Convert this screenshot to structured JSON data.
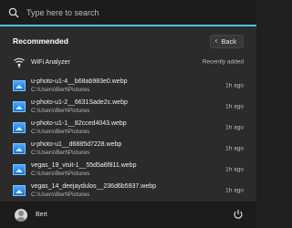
{
  "search": {
    "placeholder": "Type here to search"
  },
  "recommended": {
    "title": "Recommended",
    "back_label": "Back",
    "items": [
      {
        "name": "WiFi Analyzer",
        "sub": "",
        "time": "Recently added",
        "icon": "wifi-analyzer-icon"
      },
      {
        "name": "u-photo-u1-4__b68ab983e0.webp",
        "sub": "C:\\Users\\Bert\\Pictures",
        "time": "1h ago",
        "icon": "image-file-icon"
      },
      {
        "name": "u-photo-u1-2__6631Sade2c.webp",
        "sub": "C:\\Users\\Bert\\Pictures",
        "time": "1h ago",
        "icon": "image-file-icon"
      },
      {
        "name": "u-photo-u1-1__82cced4043.webp",
        "sub": "C:\\Users\\Bert\\Pictures",
        "time": "1h ago",
        "icon": "image-file-icon"
      },
      {
        "name": "u-photo-u1__d6885d7228.webp",
        "sub": "C:\\Users\\Bert\\Pictures",
        "time": "1h ago",
        "icon": "image-file-icon"
      },
      {
        "name": "vegas_19_visit-1__55d5a6f811.webp",
        "sub": "C:\\Users\\Bert\\Pictures",
        "time": "1h ago",
        "icon": "image-file-icon"
      },
      {
        "name": "vegas_14_deejaydulos__236d6b5937.webp",
        "sub": "C:\\Users\\Bert\\Pictures",
        "time": "1h ago",
        "icon": "image-file-icon"
      }
    ]
  },
  "footer": {
    "user_name": "Bert"
  },
  "colors": {
    "accent": "#4cc2ff",
    "panel": "#2b2b2b",
    "bar": "#1c1c1c"
  }
}
